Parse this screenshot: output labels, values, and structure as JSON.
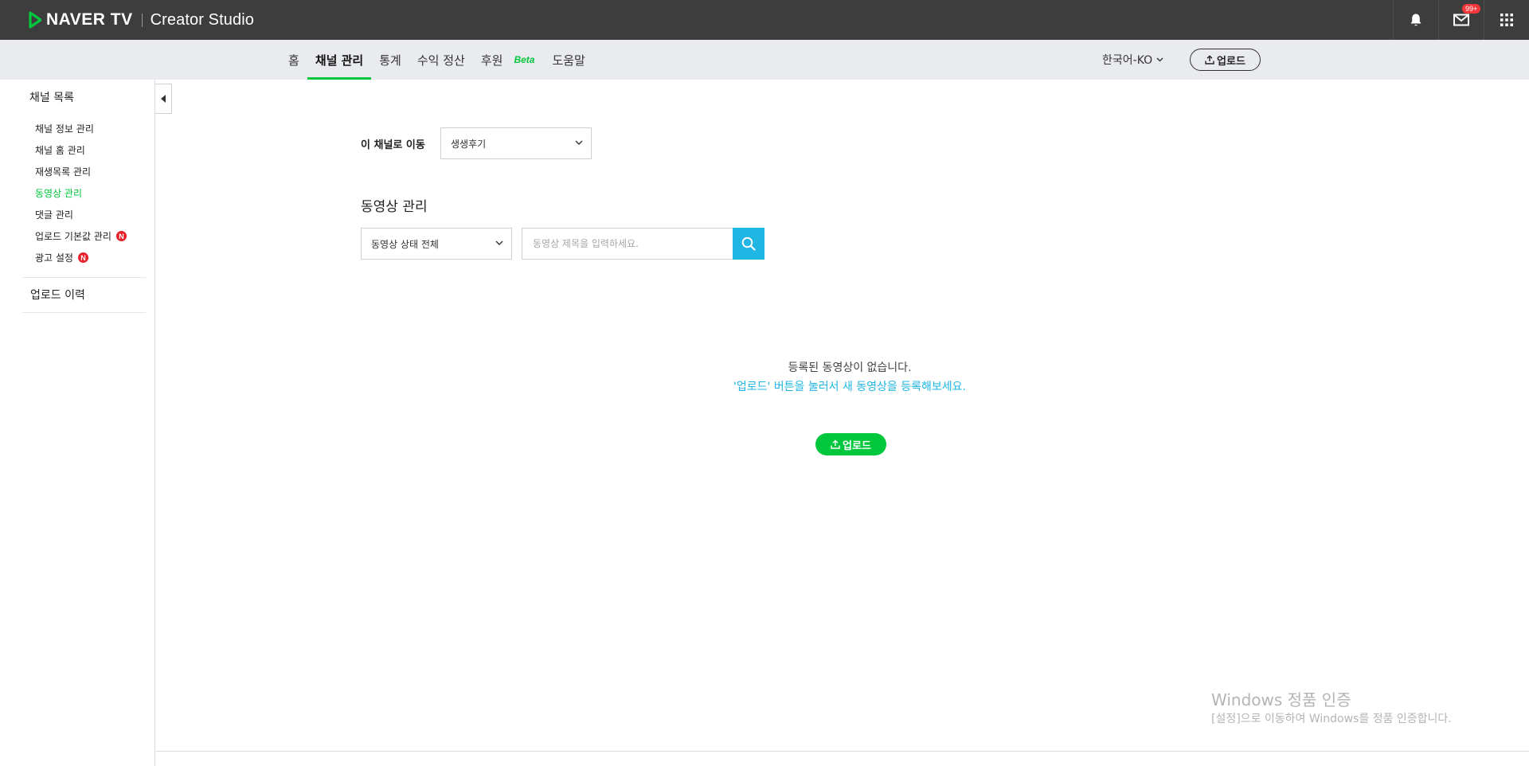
{
  "app": {
    "brand": "NAVER TV",
    "studio": "Creator Studio"
  },
  "topbar": {
    "mail_badge": "99+"
  },
  "nav": {
    "tabs": [
      {
        "label": "홈"
      },
      {
        "label": "채널 관리"
      },
      {
        "label": "통계"
      },
      {
        "label": "수익 정산"
      },
      {
        "label": "후원"
      },
      {
        "label": "도움말"
      }
    ],
    "beta_label": "Beta",
    "language": "한국어-KO",
    "upload_label": "업로드"
  },
  "sidebar": {
    "title": "채널 목록",
    "items": [
      {
        "label": "채널 정보 관리"
      },
      {
        "label": "채널 홈 관리"
      },
      {
        "label": "재생목록 관리"
      },
      {
        "label": "동영상 관리"
      },
      {
        "label": "댓글 관리"
      },
      {
        "label": "업로드 기본값 관리",
        "badge": "N"
      },
      {
        "label": "광고 설정",
        "badge": "N"
      }
    ],
    "history": "업로드 이력"
  },
  "main": {
    "move_label": "이 채널로 이동",
    "channel_selected": "생생후기",
    "section_title": "동영상 관리",
    "status_selected": "동영상 상태 전체",
    "search_placeholder": "동영상 제목을 입력하세요.",
    "empty_message": "등록된 동영상이 없습니다.",
    "empty_hint": "'업로드' 버튼을 눌러서 새 동영상을 등록해보세요.",
    "upload_label": "업로드"
  },
  "watermark": {
    "title": "Windows 정품 인증",
    "subtitle": "[설정]으로 이동하여 Windows를 정품 인증합니다."
  },
  "colors": {
    "naver_green": "#00c73c",
    "accent_blue": "#1fb6e3",
    "topbar_bg": "#3d3d3d",
    "navbar_bg": "#e9ebee",
    "badge_red": "#e8202a"
  },
  "icons": [
    "play-logo-icon",
    "bell-icon",
    "mail-icon",
    "apps-grid-icon",
    "chevron-down-icon",
    "upload-icon",
    "collapse-arrow-icon",
    "search-icon"
  ]
}
